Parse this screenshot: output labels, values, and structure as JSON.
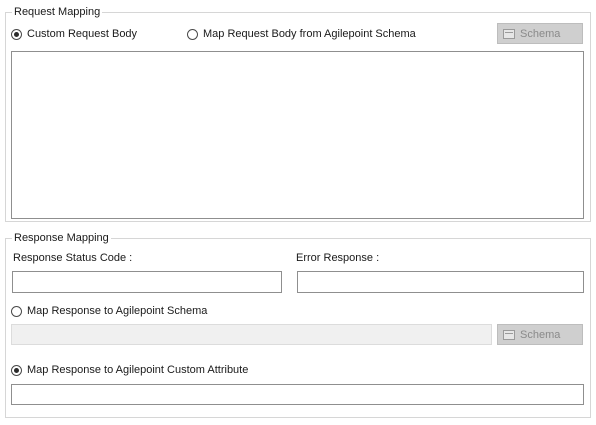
{
  "request_mapping": {
    "title": "Request Mapping",
    "custom_body_label": "Custom Request Body",
    "custom_body_selected": true,
    "map_schema_label": "Map Request Body from Agilepoint Schema",
    "map_schema_selected": false,
    "schema_button_label": "Schema",
    "body_text": ""
  },
  "response_mapping": {
    "title": "Response Mapping",
    "status_code_label": "Response Status Code :",
    "status_code_value": "",
    "error_response_label": "Error Response :",
    "error_response_value": "",
    "map_schema_label": "Map Response to Agilepoint Schema",
    "map_schema_selected": false,
    "schema_value": "",
    "schema_button_label": "Schema",
    "map_custom_attr_label": "Map Response to Agilepoint Custom Attribute",
    "map_custom_attr_selected": true,
    "custom_attr_value": ""
  },
  "icons": {
    "radio_selected": "radio-selected",
    "radio_unselected": "radio-unselected",
    "schema_button_icon": "window-icon"
  },
  "colors": {
    "group_border": "#d6d6d6",
    "input_border": "#8f8f8f",
    "button_disabled_bg": "#cfcfcf",
    "button_disabled_text": "#8a8a8a",
    "disabled_input_bg": "#f0f0f0"
  }
}
